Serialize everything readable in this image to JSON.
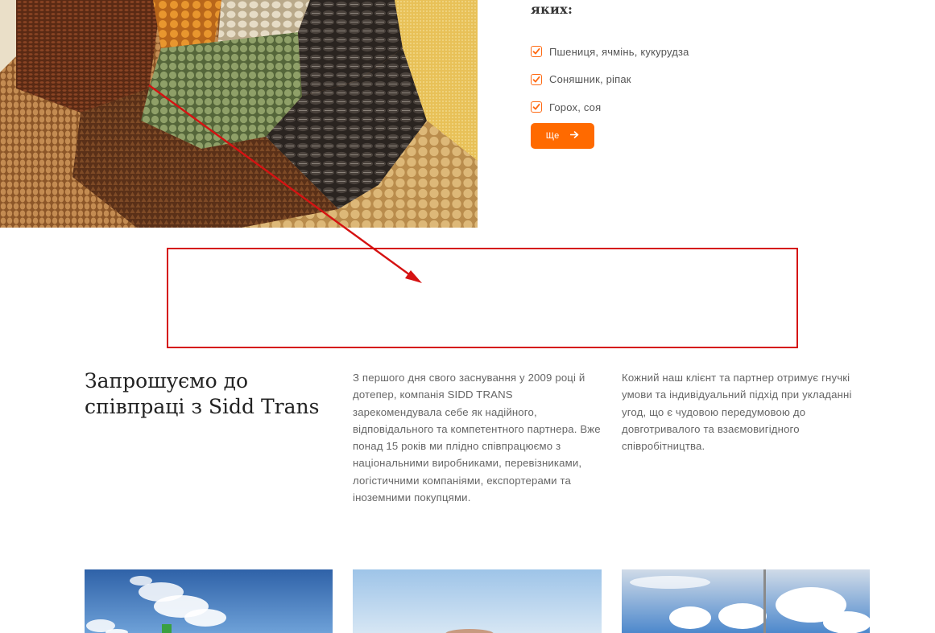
{
  "offer": {
    "heading": "яких:",
    "items": [
      {
        "label": "Пшениця, ячмінь, кукурудза"
      },
      {
        "label": "Соняшник, ріпак"
      },
      {
        "label": "Горох, соя"
      }
    ],
    "more_label": "Ще",
    "more_icon": "arrow-right-icon"
  },
  "invite": {
    "title": "Запрошуємо до співпраці з Sidd Trans",
    "column_2": "З першого дня свого заснування у 2009 році й дотепер, компанія SIDD TRANS зарекомендувала себе як надійного, відповідального та компетентного партнера. Вже понад 15 років ми плідно співпрацюємо з національними виробниками, перевізниками, логістичними компаніями, експортерами та іноземними покупцями.",
    "column_3": "Кожний наш клієнт та партнер отримує гнучкі умови та індивідуальний підхід при укладанні угод, що є чудовою передумовою до довготривалого та взаємовигідного співробітництва."
  },
  "colors": {
    "accent": "#ff6a00",
    "annotation": "#d51212",
    "heading_text": "#222222",
    "body_text": "#666666"
  }
}
